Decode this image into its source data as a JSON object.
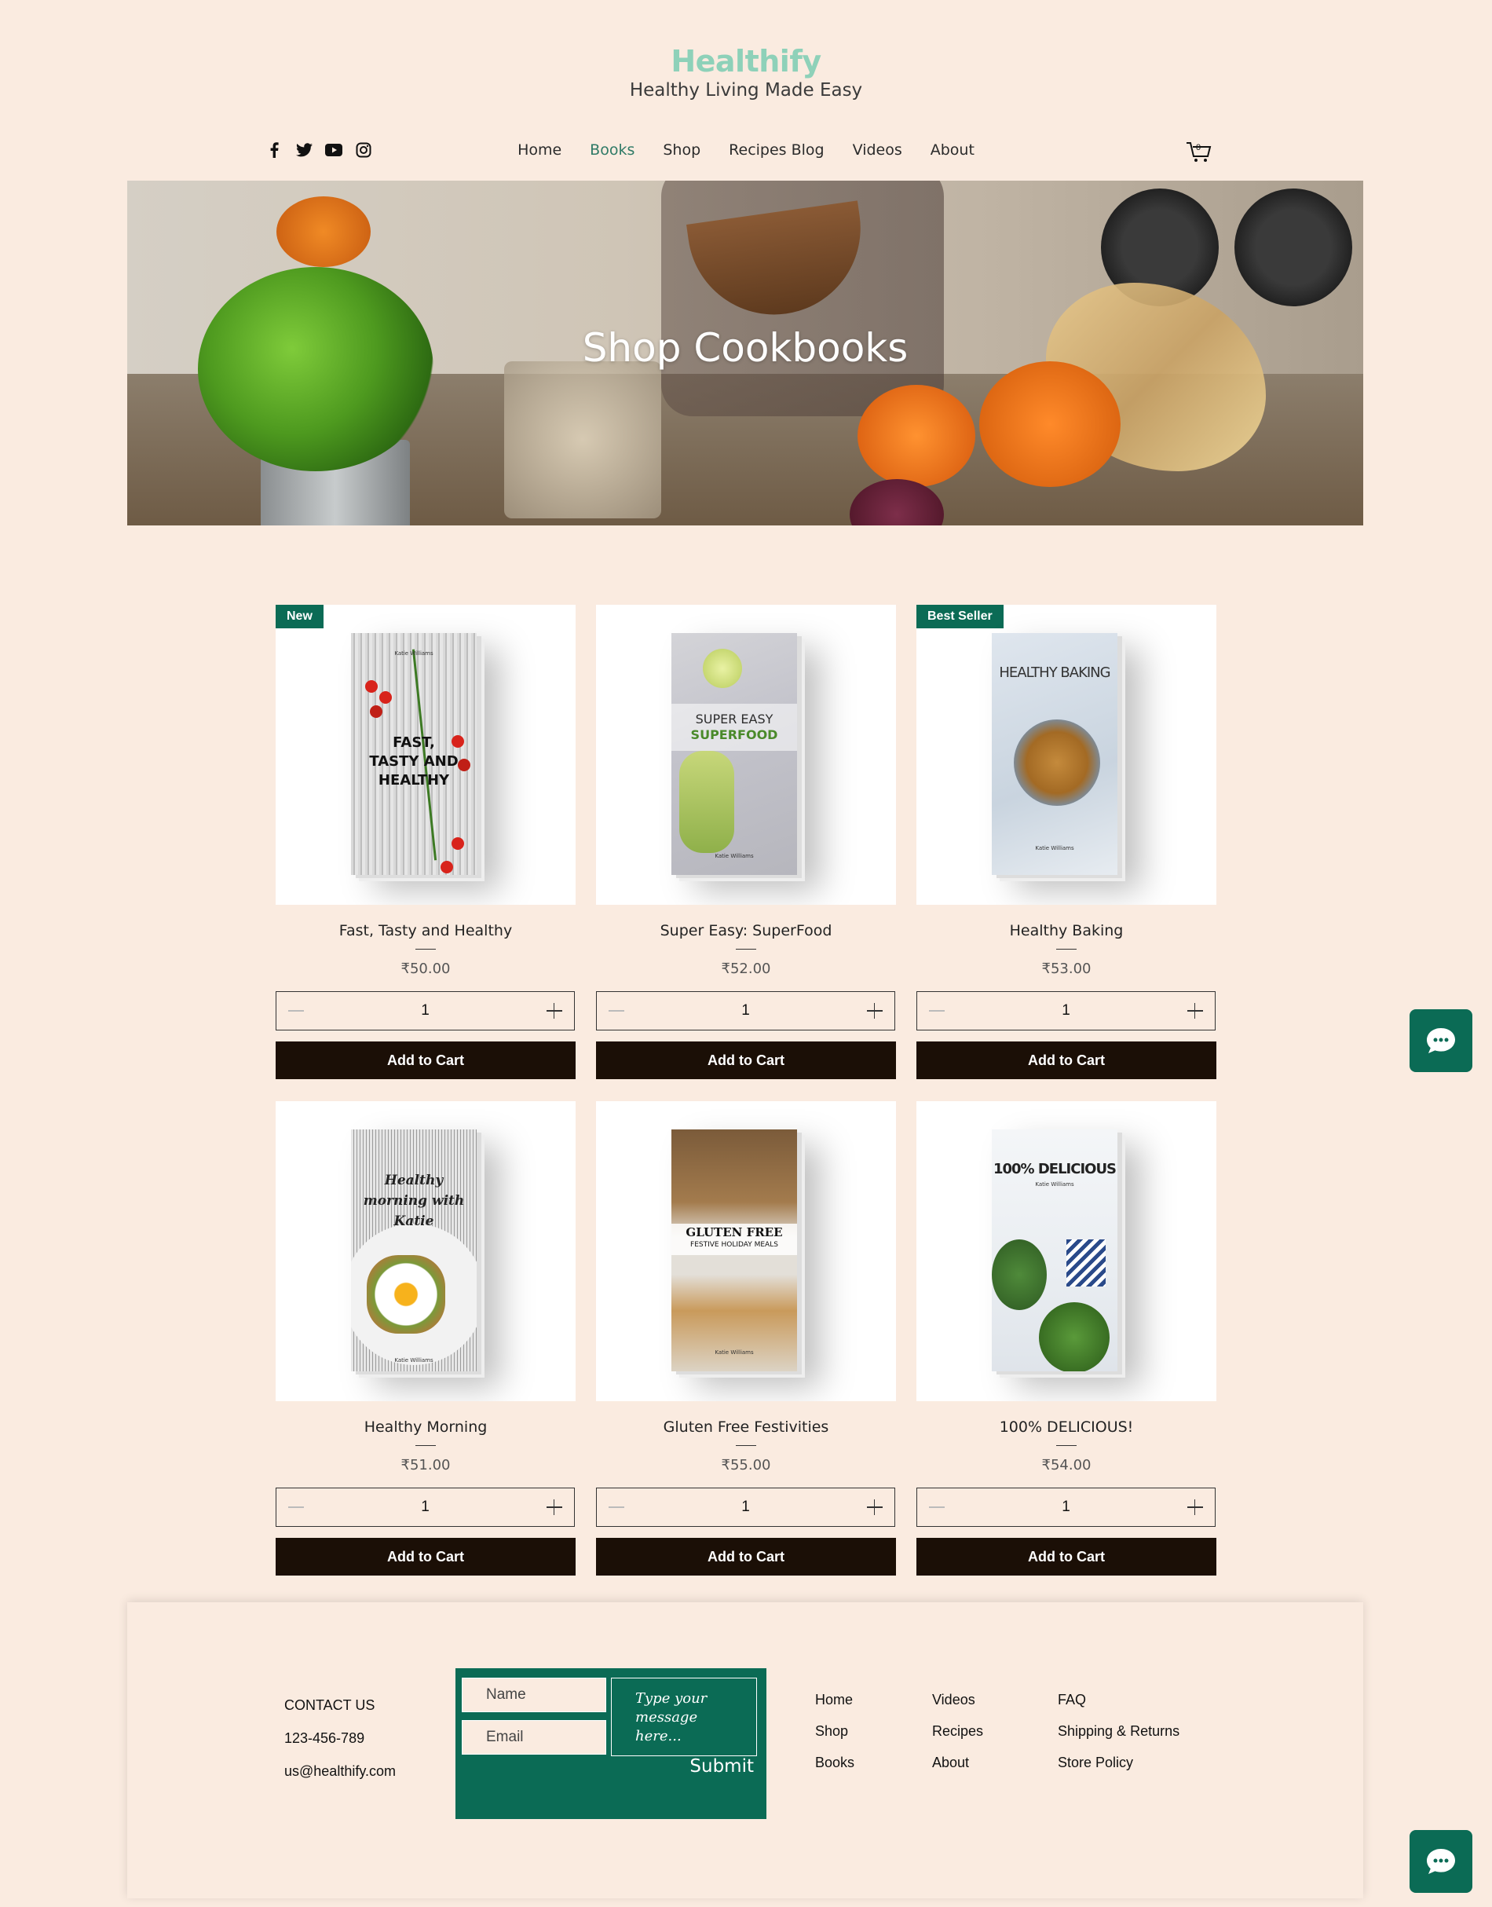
{
  "site": {
    "brand": "Healthify",
    "tagline": "Healthy Living Made Easy",
    "cart_count": "0"
  },
  "social": [
    "facebook-icon",
    "twitter-icon",
    "youtube-icon",
    "instagram-icon"
  ],
  "nav": {
    "items": [
      {
        "label": "Home"
      },
      {
        "label": "Books",
        "active": true
      },
      {
        "label": "Shop"
      },
      {
        "label": "Recipes Blog"
      },
      {
        "label": "Videos"
      },
      {
        "label": "About"
      }
    ]
  },
  "hero": {
    "title": "Shop Cookbooks"
  },
  "products": [
    {
      "name": "Fast, Tasty and Healthy",
      "price": "₹50.00",
      "qty": "1",
      "ribbon": "New",
      "add_label": "Add to Cart"
    },
    {
      "name": "Super Easy: SuperFood",
      "price": "₹52.00",
      "qty": "1",
      "ribbon": "",
      "add_label": "Add to Cart"
    },
    {
      "name": "Healthy Baking",
      "price": "₹53.00",
      "qty": "1",
      "ribbon": "Best Seller",
      "add_label": "Add to Cart"
    },
    {
      "name": "Healthy Morning",
      "price": "₹51.00",
      "qty": "1",
      "ribbon": "",
      "add_label": "Add to Cart"
    },
    {
      "name": "Gluten Free Festivities",
      "price": "₹55.00",
      "qty": "1",
      "ribbon": "",
      "add_label": "Add to Cart"
    },
    {
      "name": "100% DELICIOUS!",
      "price": "₹54.00",
      "qty": "1",
      "ribbon": "",
      "add_label": "Add to Cart"
    }
  ],
  "covers": [
    {
      "title": "FAST, TASTY AND HEALTHY",
      "author": "Katie Williams"
    },
    {
      "title": "SUPER EASY",
      "subtitle": "SUPERFOOD",
      "author": "Katie Williams"
    },
    {
      "title": "HEALTHY BAKING",
      "author": "Katie Williams"
    },
    {
      "title": "Healthy morning with Katie",
      "author": "Katie Williams"
    },
    {
      "title": "GLUTEN FREE",
      "subtitle": "FESTIVE HOLIDAY MEALS",
      "author": "Katie Williams"
    },
    {
      "title": "100% DELICIOUS",
      "author": "Katie Williams"
    }
  ],
  "footer": {
    "contact_heading": "CONTACT US",
    "phone": "123-456-789",
    "email": "us@healthify.com",
    "form": {
      "name_placeholder": "Name",
      "email_placeholder": "Email",
      "message_placeholder": "Type your message here...",
      "submit_label": "Submit"
    },
    "links_col1": [
      "Home",
      "Shop",
      "Books"
    ],
    "links_col2": [
      "Videos",
      "Recipes",
      "About"
    ],
    "links_col3": [
      "FAQ",
      "Shipping & Returns",
      "Store Policy"
    ]
  }
}
